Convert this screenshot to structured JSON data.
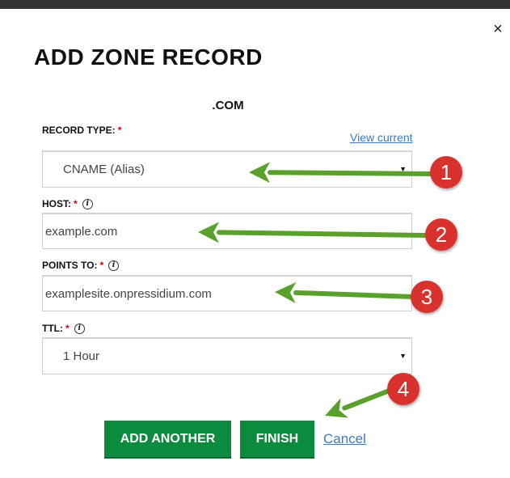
{
  "dialog": {
    "title": "ADD ZONE RECORD",
    "domain": ".COM",
    "close_glyph": "×"
  },
  "record_type": {
    "label": "RECORD TYPE:",
    "required_mark": "*",
    "view_current": "View current",
    "value": "CNAME (Alias)"
  },
  "host": {
    "label": "HOST:",
    "required_mark": "*",
    "value": "example.com"
  },
  "points_to": {
    "label": "POINTS TO:",
    "required_mark": "*",
    "value": "examplesite.onpressidium.com"
  },
  "ttl": {
    "label": "TTL:",
    "required_mark": "*",
    "value": "1 Hour"
  },
  "buttons": {
    "add_another": "ADD ANOTHER",
    "finish": "FINISH",
    "cancel": "Cancel"
  },
  "annotations": {
    "arrow_color": "#5aa02c",
    "badge_color": "#d9312f",
    "badges": [
      "1",
      "2",
      "3",
      "4"
    ]
  },
  "colors": {
    "button_green": "#0c8a3e",
    "link_blue": "#3a7bbf",
    "required_red": "#d0021b"
  }
}
